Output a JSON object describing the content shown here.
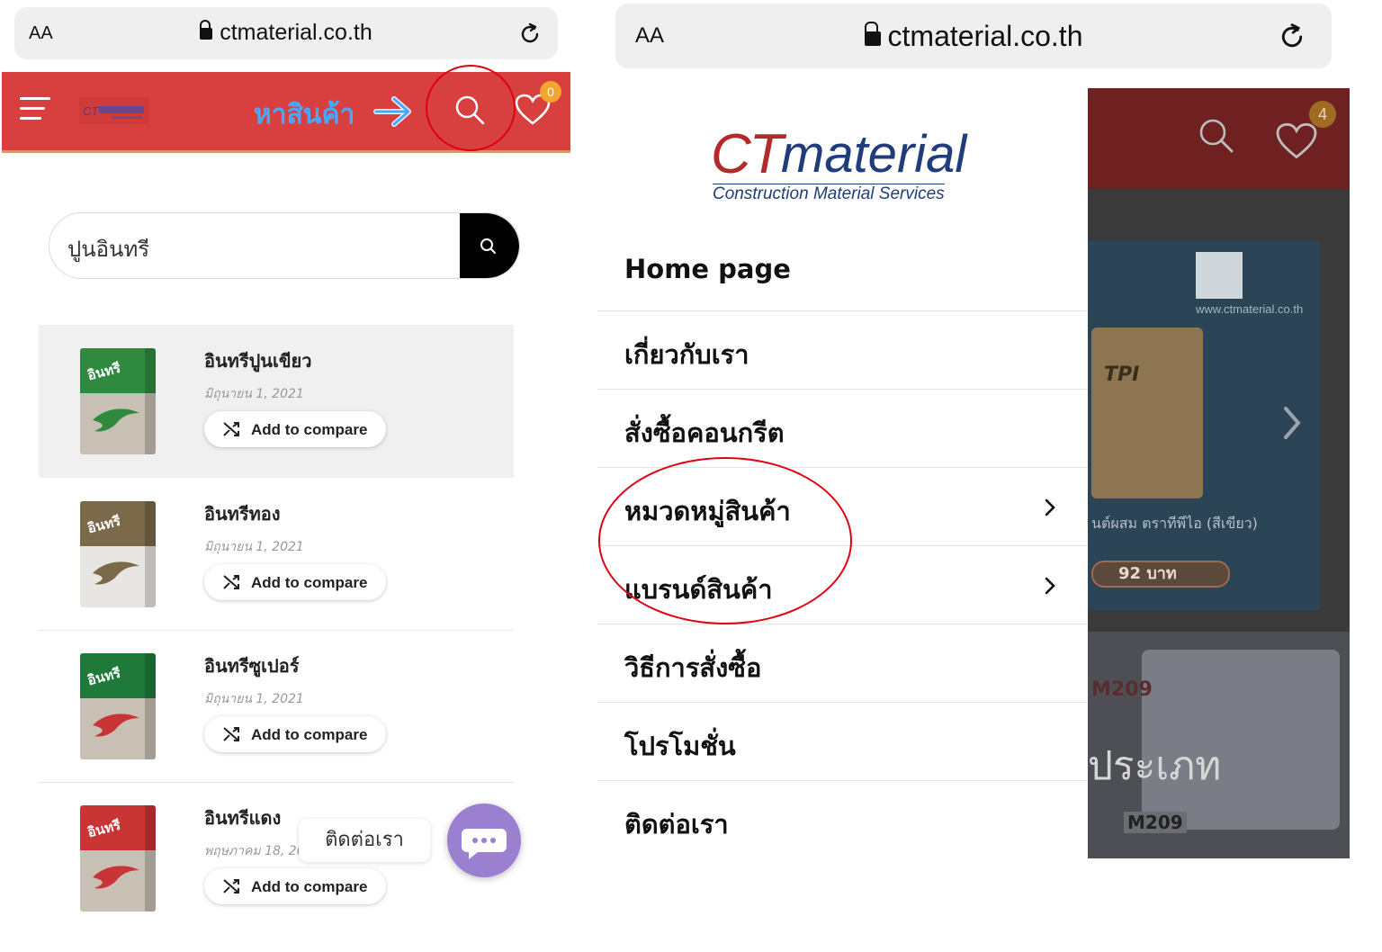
{
  "left": {
    "browser": {
      "aa": "AA",
      "domain": "ctmaterial.co.th"
    },
    "header": {
      "search_hint": "หาสินค้า",
      "wishlist_count": "0"
    },
    "search": {
      "query": "ปูนอินทรี"
    },
    "products": [
      {
        "name": "อินทรีปูนเขียว",
        "date": "มิถุนายน 1, 2021",
        "compare": "Add to compare",
        "bag_color": "#2f8a3f",
        "brand": "อินทรี"
      },
      {
        "name": "อินทรีทอง",
        "date": "มิถุนายน 1, 2021",
        "compare": "Add to compare",
        "bag_color": "#7b6a4a",
        "brand": "อินทรี"
      },
      {
        "name": "อินทรีซูเปอร์",
        "date": "มิถุนายน 1, 2021",
        "compare": "Add to compare",
        "bag_color": "#1f7a3a",
        "brand": "อินทรี"
      },
      {
        "name": "อินทรีแดง",
        "date": "พฤษภาคม 18, 2021",
        "compare": "Add to compare",
        "bag_color": "#c93434",
        "brand": "อินทรี"
      }
    ],
    "chat": {
      "label": "ติดต่อเรา"
    }
  },
  "right": {
    "browser": {
      "aa": "AA",
      "domain": "ctmaterial.co.th"
    },
    "logo": {
      "ct": "CT",
      "material": "material",
      "tagline": "Construction Material Services"
    },
    "menu": [
      {
        "label": "Home page",
        "has_children": false
      },
      {
        "label": "เกี่ยวกับเรา",
        "has_children": false
      },
      {
        "label": "สั่งซื้อคอนกรีต",
        "has_children": false
      },
      {
        "label": "หมวดหมู่สินค้า",
        "has_children": true
      },
      {
        "label": "แบรนด์สินค้า",
        "has_children": true
      },
      {
        "label": "วิธีการสั่งซื้อ",
        "has_children": false
      },
      {
        "label": "โปรโมชั่น",
        "has_children": false
      },
      {
        "label": "ติดต่อเรา",
        "has_children": false
      }
    ],
    "background": {
      "wishlist_count": "4",
      "site": "www.ctmaterial.co.th",
      "product_label": "TPI",
      "product_desc": "นต์ผสม ตราทีพีไอ (สีเขียว)",
      "price": "92 บาท",
      "truck_plate": "M209",
      "truck_text": "ประเภท"
    }
  },
  "colors": {
    "header_red": "#d8403f",
    "annotation_red": "#e0000f",
    "search_hint_blue": "#4aa7ff",
    "chat_purple": "#9b7fd1",
    "badge_orange": "#f2a531"
  }
}
